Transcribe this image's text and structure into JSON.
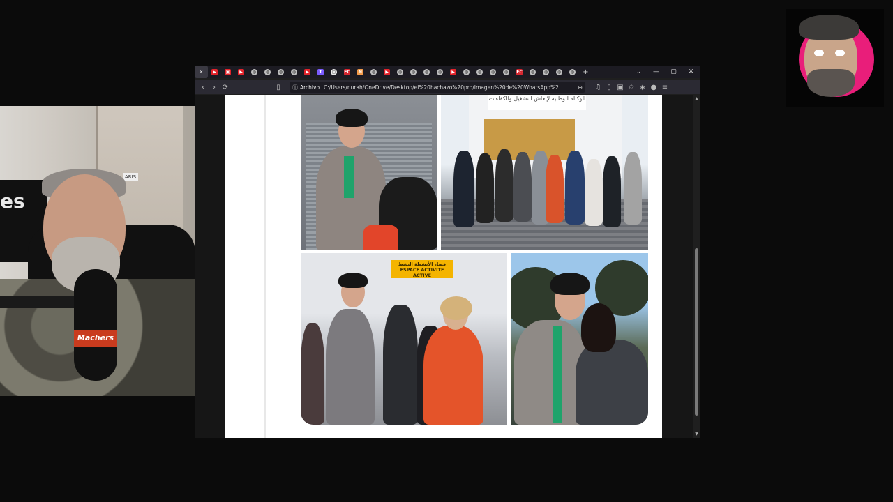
{
  "browser": {
    "tabs": [
      {
        "icon": "close-icon",
        "color": "#ffffff",
        "glyph": "✕"
      },
      {
        "icon": "youtube-favicon",
        "color": "#e3232a",
        "glyph": "▶"
      },
      {
        "icon": "news-favicon",
        "color": "#e3232a",
        "glyph": "▣"
      },
      {
        "icon": "youtube-favicon",
        "color": "#e3232a",
        "glyph": "▶"
      },
      {
        "icon": "globe-favicon",
        "color": "#bdbdbd",
        "glyph": "◍"
      },
      {
        "icon": "globe-favicon",
        "color": "#bdbdbd",
        "glyph": "◍"
      },
      {
        "icon": "globe-favicon",
        "color": "#bdbdbd",
        "glyph": "◍"
      },
      {
        "icon": "globe-favicon",
        "color": "#bdbdbd",
        "glyph": "◍"
      },
      {
        "icon": "youtube-favicon",
        "color": "#e3232a",
        "glyph": "▶"
      },
      {
        "icon": "t-favicon",
        "color": "#7b5cff",
        "glyph": "T"
      },
      {
        "icon": "doc-favicon",
        "color": "#eaeaea",
        "glyph": "▢"
      },
      {
        "icon": "ec-favicon",
        "color": "#d7262e",
        "glyph": "EC"
      },
      {
        "icon": "n-favicon",
        "color": "#f39c4a",
        "glyph": "N"
      },
      {
        "icon": "globe-favicon",
        "color": "#bdbdbd",
        "glyph": "◍"
      },
      {
        "icon": "youtube-favicon",
        "color": "#e3232a",
        "glyph": "▶"
      },
      {
        "icon": "globe-favicon",
        "color": "#bdbdbd",
        "glyph": "◍"
      },
      {
        "icon": "globe-favicon",
        "color": "#bdbdbd",
        "glyph": "◍"
      },
      {
        "icon": "globe-favicon",
        "color": "#bdbdbd",
        "glyph": "◍"
      },
      {
        "icon": "globe-favicon",
        "color": "#bdbdbd",
        "glyph": "◍"
      },
      {
        "icon": "youtube-favicon",
        "color": "#e3232a",
        "glyph": "▶"
      },
      {
        "icon": "globe-favicon",
        "color": "#bdbdbd",
        "glyph": "◍"
      },
      {
        "icon": "globe-favicon",
        "color": "#bdbdbd",
        "glyph": "◍"
      },
      {
        "icon": "globe-favicon",
        "color": "#bdbdbd",
        "glyph": "◍"
      },
      {
        "icon": "globe-favicon",
        "color": "#bdbdbd",
        "glyph": "◍"
      },
      {
        "icon": "ec-favicon",
        "color": "#d7262e",
        "glyph": "EC"
      },
      {
        "icon": "globe-favicon",
        "color": "#bdbdbd",
        "glyph": "◍"
      },
      {
        "icon": "globe-favicon",
        "color": "#bdbdbd",
        "glyph": "◍"
      },
      {
        "icon": "globe-favicon",
        "color": "#bdbdbd",
        "glyph": "◍"
      },
      {
        "icon": "globe-favicon",
        "color": "#bdbdbd",
        "glyph": "◍"
      }
    ],
    "new_tab": "+",
    "tab_list": "⌄",
    "minimize": "—",
    "maximize": "▢",
    "close": "✕",
    "back": "‹",
    "forward": "›",
    "reload": "⟳",
    "bookmark": "▯",
    "url_label": "Archivo",
    "url": "C:/Users/nurah/OneDrive/Desktop/el%20hachazo%20pro/Imagen%20de%20WhatsApp%2...",
    "zoom": "⊕",
    "toolbar_icons": [
      "♫",
      "▯",
      "▣",
      "✩",
      "◈",
      "●",
      "≡"
    ]
  },
  "photos": {
    "sign_building": "الوكالة الوطنية لإنعاش التشغيل والكفاءات",
    "sign_space_ar": "فضاء الأنشطة النشط",
    "sign_space_fr": "ESPACE ACTIVITE ACTIVE"
  },
  "webcam": {
    "tv_label": "es",
    "room_sign": "ARIS",
    "mic_label": "Machers"
  }
}
